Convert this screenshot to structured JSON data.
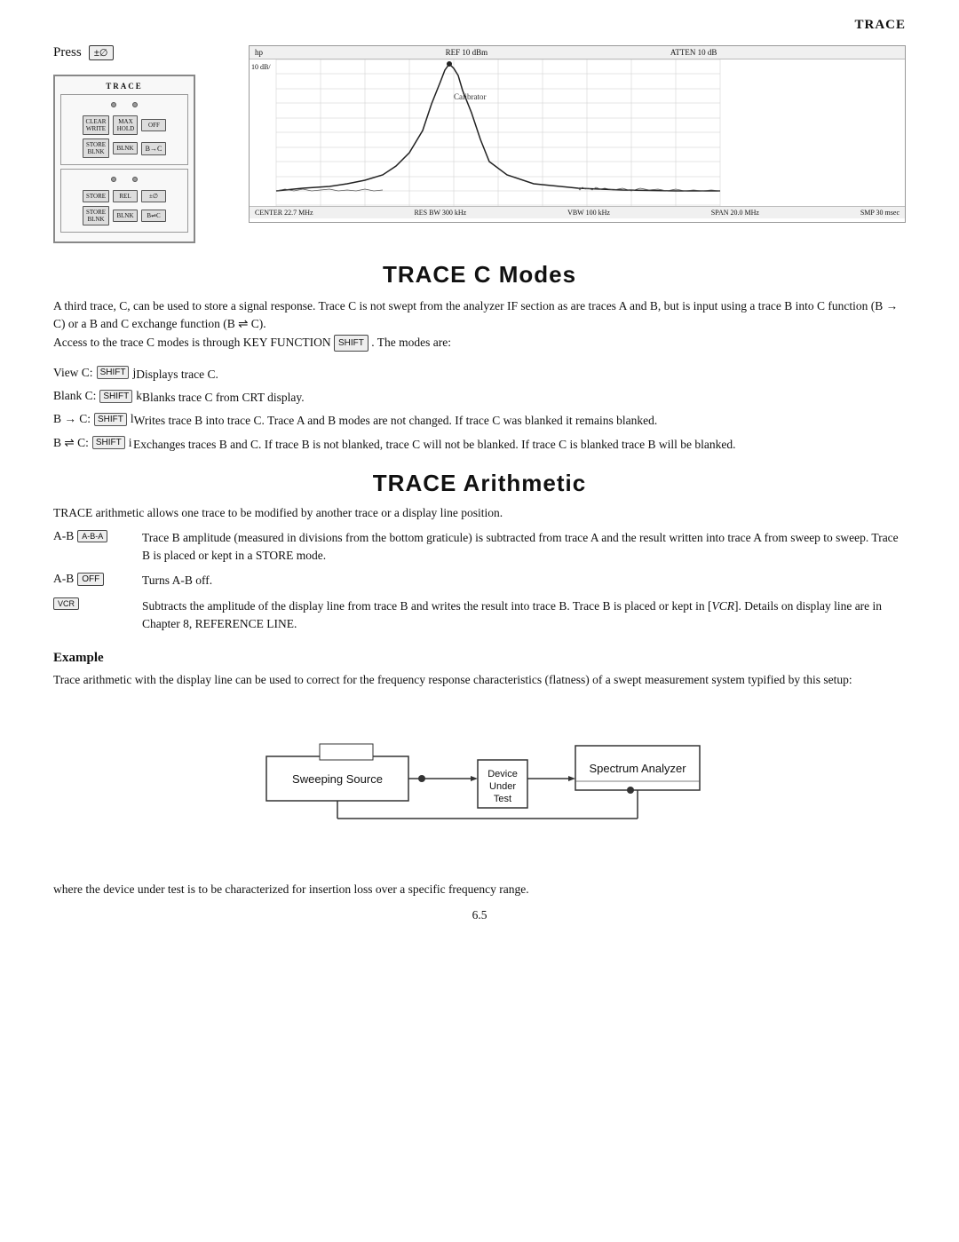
{
  "header": {
    "title": "TRACE"
  },
  "top": {
    "press_label": "Press",
    "press_key": "±∅",
    "graph": {
      "top_left": "hp",
      "ref": "REF 10 dBm",
      "atten": "ATTEN 10 dB",
      "y_label": "10 dB/",
      "center": "CENTER 22.7 MHz",
      "res_bw": "RES BW 300 kHz",
      "vbw": "VBW 100 kHz",
      "span": "SPAN 20.0 MHz",
      "smp": "SMP 30 msec"
    }
  },
  "trace_c": {
    "title": "TRACE C Modes",
    "para1": "A third trace, C, can be used to store a signal response. Trace C is not swept from the analyzer IF section as are traces A and B, but is input using a trace B into C function (B → C) or a B and C exchange function (B ⇌ C).",
    "para2": "Access to the trace C modes is through KEY FUNCTION",
    "key_function_key": "SHIFT",
    "para2_end": ". The modes are:",
    "modes": [
      {
        "label": "View C:",
        "key_prefix": "SHIFT",
        "key_suffix": "j",
        "desc": "Displays trace C."
      },
      {
        "label": "Blank C:",
        "key_prefix": "SHIFT",
        "key_suffix": "k",
        "desc": "Blanks trace C from CRT display."
      },
      {
        "label": "B → C:",
        "key_prefix": "SHIFT",
        "key_suffix": "l",
        "desc": "Writes trace B into trace C. Trace A and B modes are not changed. If trace C was blanked it remains blanked."
      },
      {
        "label": "B ⇌ C:",
        "key_prefix": "SHIFT",
        "key_suffix": "i",
        "desc": "Exchanges traces B and C. If trace B is not blanked, trace C will not be blanked. If trace C is blanked trace B will be blanked."
      }
    ]
  },
  "trace_arith": {
    "title": "TRACE Arithmetic",
    "intro": "TRACE arithmetic allows one trace to be modified by another trace or a display line position.",
    "rows": [
      {
        "label": "A-B",
        "key": "A-B-A",
        "desc": "Trace B amplitude (measured in divisions from the bottom graticule) is subtracted from trace A and the result written into trace A from sweep to sweep. Trace B is placed or kept in a STORE mode."
      },
      {
        "label": "A-B",
        "key": "OFF",
        "desc": "Turns A-B off."
      },
      {
        "label": "",
        "key": "VCR",
        "desc": "Subtracts the amplitude of the display line from trace B and writes the result into trace B. Trace B is placed or kept in [VCR]. Details on display line are in Chapter 8, REFERENCE LINE."
      }
    ]
  },
  "example": {
    "title": "Example",
    "body": "Trace arithmetic with the display line can be used to correct for the frequency response characteristics (flatness) of a swept measurement system typified by this setup:",
    "diagram": {
      "sweeping_source": "Sweeping Source",
      "spectrum_analyzer": "Spectrum Analyzer",
      "device_under_test": "Device\nUnder\nTest"
    }
  },
  "footer": {
    "where_text": "where the device under test is to be characterized for insertion loss over a specific frequency range.",
    "page_number": "6.5"
  }
}
